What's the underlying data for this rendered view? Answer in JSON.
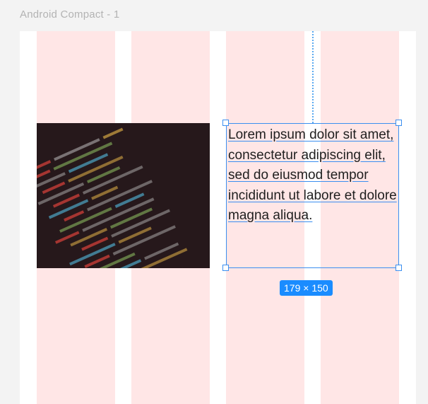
{
  "frame": {
    "label": "Android Compact - 1"
  },
  "layout_grid": {
    "columns": 4,
    "column_color": "#ffe6e6"
  },
  "image": {
    "description_icon": "code-screenshot-image"
  },
  "text_layer": {
    "content": "Lorem ipsum dolor sit amet, consectetur adipiscing elit, sed do eiusmod tempor incididunt ut  labore et dolore magna aliqua."
  },
  "selection": {
    "size_label": "179 × 150",
    "accent_color": "#1a8cff"
  }
}
